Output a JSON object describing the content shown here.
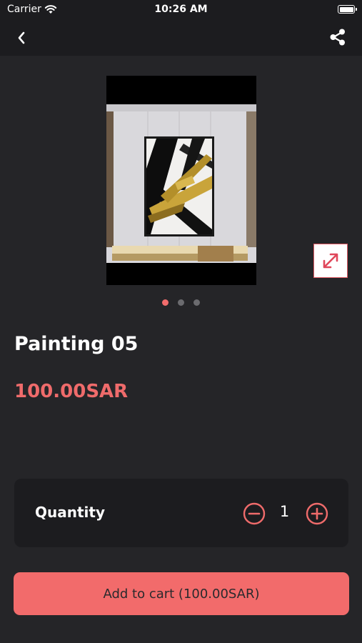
{
  "status_bar": {
    "carrier": "Carrier",
    "time": "10:26 AM"
  },
  "nav": {
    "back_icon": "chevron-left-icon",
    "share_icon": "share-icon"
  },
  "gallery": {
    "image": "abstract black and gold painting in interior",
    "expand_icon": "expand-arrows-icon",
    "page_count": 3,
    "active_page": 1
  },
  "product": {
    "title": "Painting 05",
    "price": "100.00SAR"
  },
  "quantity": {
    "label": "Quantity",
    "value": "1",
    "minus_icon": "minus-circle-icon",
    "plus_icon": "plus-circle-icon"
  },
  "cart": {
    "button_label": "Add to cart (100.00SAR)"
  },
  "colors": {
    "background": "#252528",
    "card": "#1c1c1f",
    "accent": "#f26b6b"
  }
}
